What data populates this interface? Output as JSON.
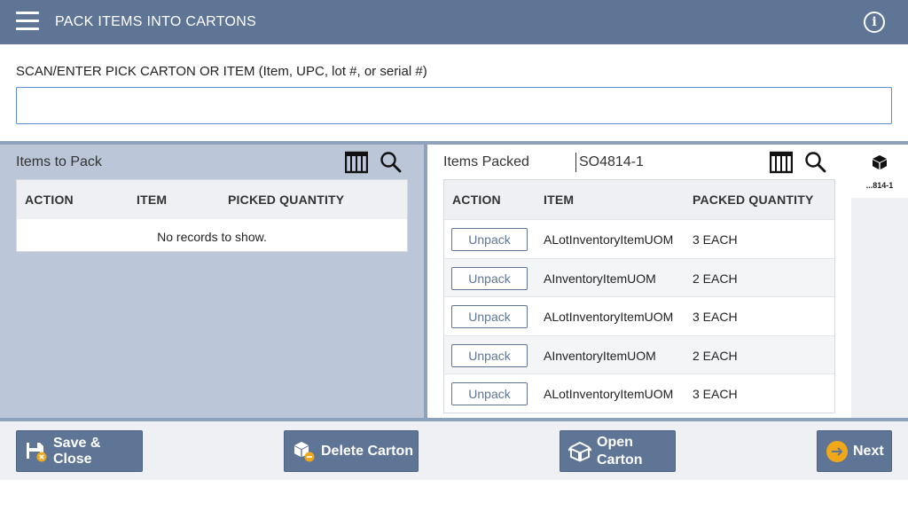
{
  "header": {
    "title": "PACK ITEMS INTO CARTONS",
    "menu_icon": "hamburger-menu-icon",
    "info_icon": "info-icon"
  },
  "scan": {
    "label": "SCAN/ENTER PICK CARTON OR ITEM (Item, UPC, lot #, or serial #)",
    "value": "",
    "placeholder": ""
  },
  "items_to_pack": {
    "title": "Items to Pack",
    "columns": [
      "ACTION",
      "ITEM",
      "PICKED QUANTITY"
    ],
    "empty_message": "No records to show."
  },
  "items_packed": {
    "title": "Items Packed",
    "carton": "SO4814-1",
    "columns": [
      "ACTION",
      "ITEM",
      "PACKED QUANTITY"
    ],
    "rows": [
      {
        "action": "Unpack",
        "item": "ALotInventoryItemUOM",
        "qty": "3 EACH"
      },
      {
        "action": "Unpack",
        "item": "AInventoryItemUOM",
        "qty": "2 EACH"
      },
      {
        "action": "Unpack",
        "item": "ALotInventoryItemUOM",
        "qty": "3 EACH"
      },
      {
        "action": "Unpack",
        "item": "AInventoryItemUOM",
        "qty": "2 EACH"
      },
      {
        "action": "Unpack",
        "item": "ALotInventoryItemUOM",
        "qty": "3 EACH"
      }
    ]
  },
  "carton_tab": {
    "label": "...814-1",
    "icon": "box-icon"
  },
  "footer": {
    "save_close": "Save & Close",
    "delete_carton": "Delete Carton",
    "open_carton_line1": "Open",
    "open_carton_line2": "Carton",
    "next": "Next"
  },
  "colors": {
    "header": "#5f7596",
    "accent_next": "#f0a81a"
  }
}
